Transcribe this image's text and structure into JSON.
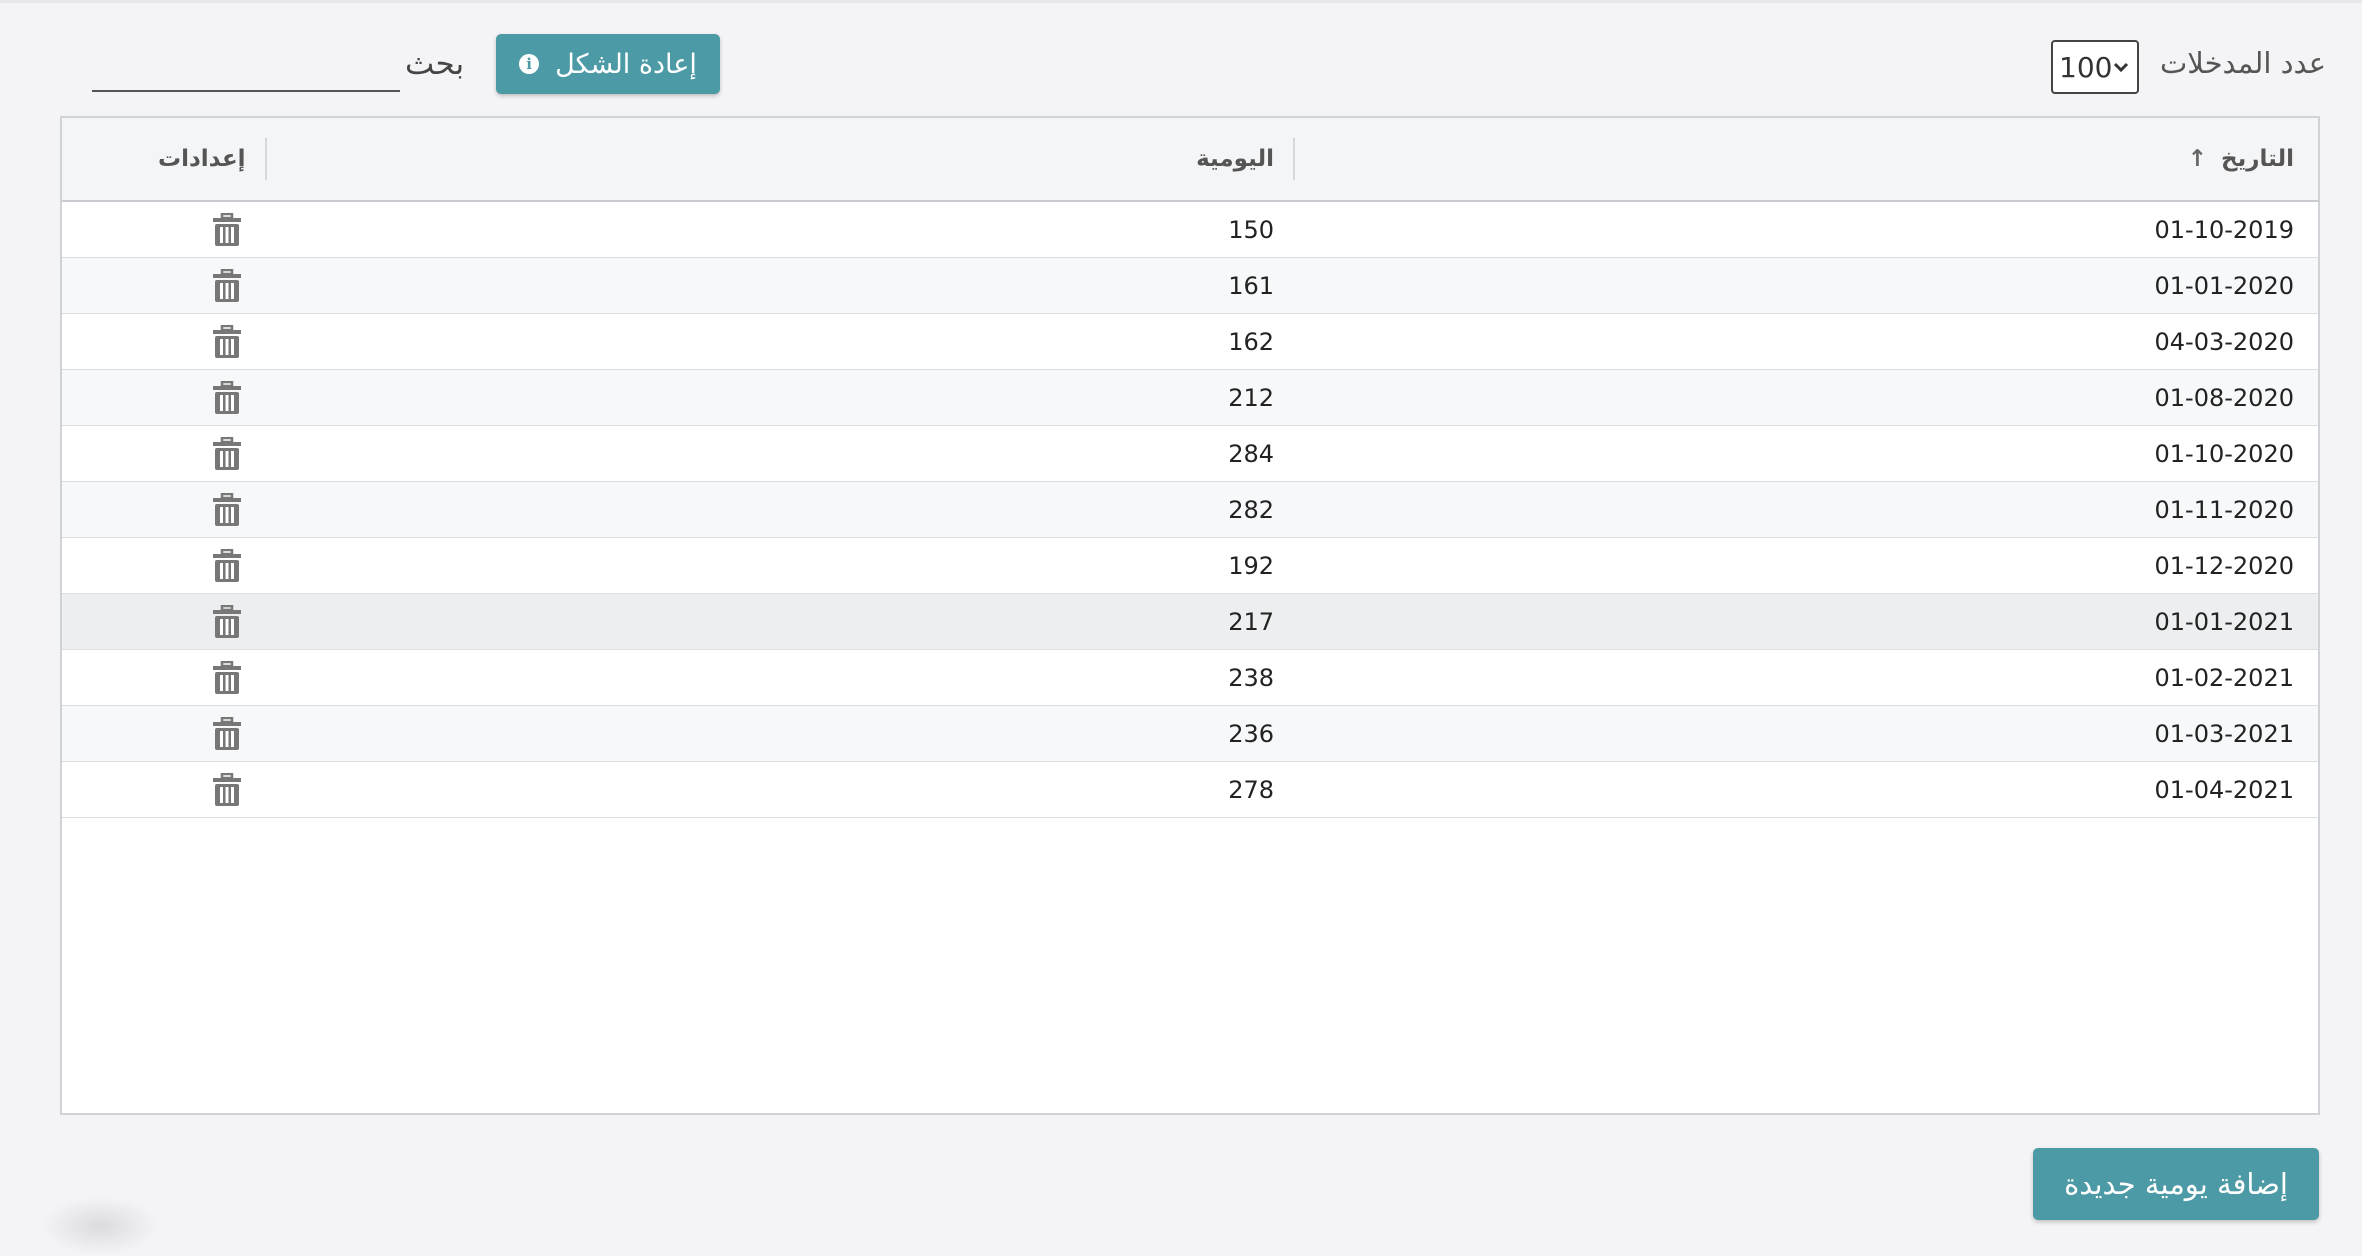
{
  "toolbar": {
    "entries_label": "عدد المدخلات",
    "entries_value": "100",
    "reset_label": "إعادة الشكل",
    "search_label": "بحث",
    "search_value": ""
  },
  "table": {
    "columns": {
      "date": "التاريخ",
      "daily": "اليومية",
      "settings": "إعدادات"
    },
    "sort_indicator": "↑",
    "rows": [
      {
        "date": "01-10-2019",
        "daily": "150"
      },
      {
        "date": "01-01-2020",
        "daily": "161"
      },
      {
        "date": "04-03-2020",
        "daily": "162"
      },
      {
        "date": "01-08-2020",
        "daily": "212"
      },
      {
        "date": "01-10-2020",
        "daily": "284"
      },
      {
        "date": "01-11-2020",
        "daily": "282"
      },
      {
        "date": "01-12-2020",
        "daily": "192"
      },
      {
        "date": "01-01-2021",
        "daily": "217"
      },
      {
        "date": "01-02-2021",
        "daily": "238"
      },
      {
        "date": "01-03-2021",
        "daily": "236"
      },
      {
        "date": "01-04-2021",
        "daily": "278"
      }
    ],
    "highlighted_row": 7,
    "row_action_icon": "trash-icon"
  },
  "footer": {
    "add_label": "إضافة يومية جديدة"
  },
  "colors": {
    "accent": "#4c9aa5",
    "header_bg": "#f4f5f6",
    "page_bg": "#f4f4f6"
  }
}
